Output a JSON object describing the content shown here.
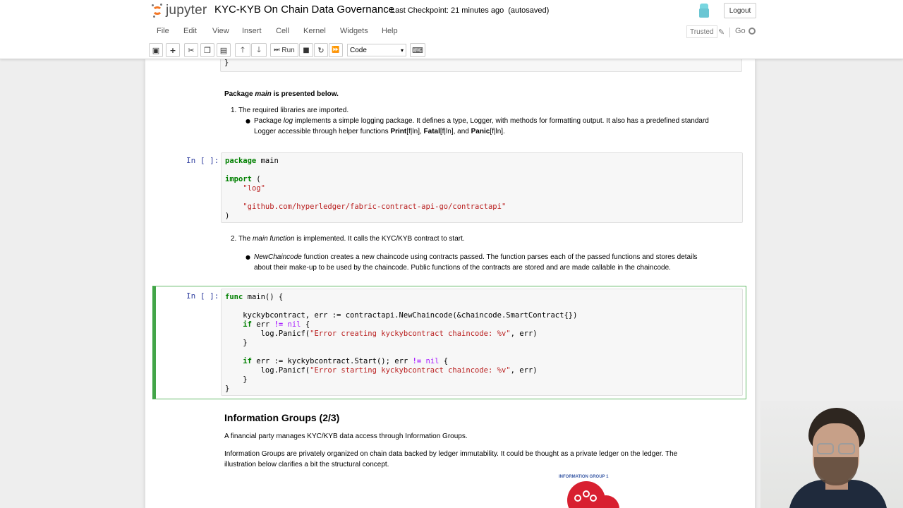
{
  "header": {
    "logo_text": "jupyter",
    "title": "KYC-KYB On Chain Data Governance",
    "checkpoint": "Last Checkpoint: 21 minutes ago",
    "autosaved": "(autosaved)",
    "logout_label": "Logout"
  },
  "menu": {
    "items": [
      "File",
      "Edit",
      "View",
      "Insert",
      "Cell",
      "Kernel",
      "Widgets",
      "Help"
    ],
    "trusted_label": "Trusted",
    "kernel_name": "Go"
  },
  "toolbar": {
    "run_label": "Run",
    "cell_type": "Code",
    "icons": [
      "save-icon",
      "add-cell-icon",
      "cut-icon",
      "copy-icon",
      "paste-icon",
      "move-up-icon",
      "move-down-icon",
      "run-icon",
      "stop-icon",
      "restart-icon",
      "fast-forward-icon",
      "keyboard-icon"
    ]
  },
  "cells": {
    "prev_code_tail": "}",
    "md1": {
      "intro_prefix": "Package ",
      "intro_em": "main",
      "intro_suffix": " is presented below.",
      "item1": "1. The required libraries are imported.",
      "bullet1_a": "Package ",
      "bullet1_em": "log",
      "bullet1_b": " implements a simple logging package. It defines a type, Logger, with methods for formatting output. It also has a predefined standard",
      "bullet1_c": "Logger accessible through helper functions ",
      "bullet1_print": "Print",
      "bullet1_print_suffix": "[f|ln], ",
      "bullet1_fatal": "Fatal",
      "bullet1_fatal_suffix": "[f|ln], and ",
      "bullet1_panic": "Panic",
      "bullet1_panic_suffix": "[f|ln]."
    },
    "code1": {
      "prompt": "In [ ]:",
      "l1_kw": "package",
      "l1_rest": " main",
      "l3_kw": "import",
      "l3_rest": " (",
      "l4": "\"log\"",
      "l6": "\"github.com/hyperledger/fabric-contract-api-go/contractapi\"",
      "l7": ")"
    },
    "md2": {
      "item2_a": "2. The ",
      "item2_em": "main function",
      "item2_b": " is implemented. It calls the KYC/KYB contract to start.",
      "bullet2_em": "NewChaincode",
      "bullet2_a": " function creates a new chaincode using contracts passed. The function parses each of the passed functions and stores details",
      "bullet2_b": "about their make-up to be used by the chaincode. Public functions of the contracts are stored and are made callable in the chaincode."
    },
    "code2": {
      "prompt": "In [ ]:",
      "l1_kw": "func",
      "l1_rest": " main() {",
      "l3": "kyckybcontract, err := contractapi.NewChaincode(&chaincode.SmartContract{})",
      "l4_kw": "if",
      "l4_a": " err ",
      "l4_op": "!=",
      "l4_nil": " nil",
      "l4_b": " {",
      "l5_a": "log.Panicf(",
      "l5_str": "\"Error creating kyckybcontract chaincode: %v\"",
      "l5_b": ", err)",
      "l6": "}",
      "l8_kw": "if",
      "l8_a": " err := kyckybcontract.Start(); err ",
      "l8_op": "!=",
      "l8_nil": " nil",
      "l8_b": " {",
      "l9_a": "log.Panicf(",
      "l9_str": "\"Error starting kyckybcontract chaincode: %v\"",
      "l9_b": ", err)",
      "l10": "}",
      "l11": "}"
    },
    "md3": {
      "heading": "Information Groups (2/3)",
      "p1": "A financial party manages KYC/KYB data access through Information Groups.",
      "p2_a": "Information Groups are privately organized on chain data backed by ledger immutability. It could be thought as a private ledger on the ledger. The",
      "p2_b": "illustration below clarifies a bit the structural concept.",
      "illustration_label": "INFORMATION GROUP 1"
    }
  },
  "colors": {
    "jupyter_orange": "#f37726",
    "prompt_blue": "#303f9f",
    "selected_green": "#42a548",
    "keyword_green": "#008000",
    "string_red": "#ba2121",
    "nil_purple": "#aa22ff",
    "illustration_red": "#d82030"
  }
}
